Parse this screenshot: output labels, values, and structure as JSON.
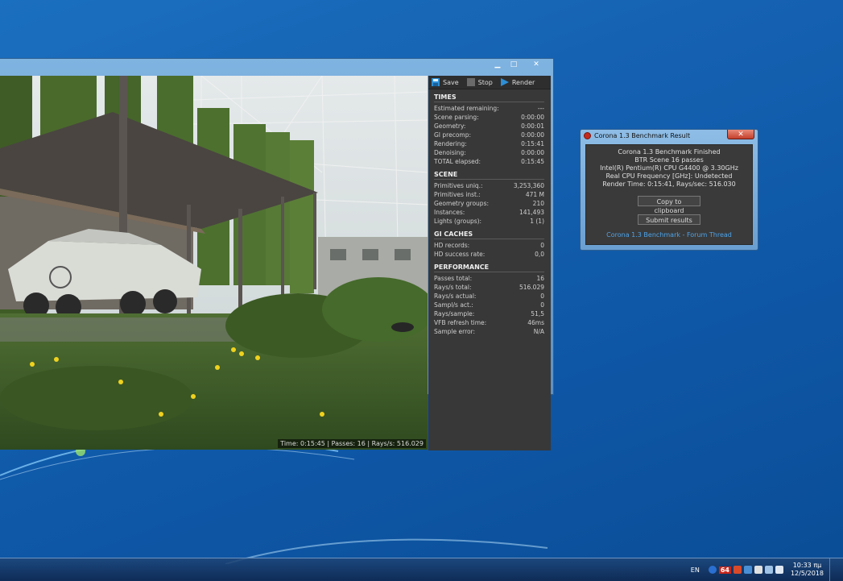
{
  "vfb": {
    "toolbar": {
      "save": "Save",
      "stop": "Stop",
      "render": "Render"
    },
    "status": "Time: 0:15:45 | Passes: 16 | Rays/s: 516.029",
    "sections": [
      {
        "title": "TIMES",
        "rows": [
          {
            "label": "Estimated remaining:",
            "value": "---"
          },
          {
            "label": "Scene parsing:",
            "value": "0:00:00"
          },
          {
            "label": "Geometry:",
            "value": "0:00:01"
          },
          {
            "label": "GI precomp:",
            "value": "0:00:00"
          },
          {
            "label": "Rendering:",
            "value": "0:15:41"
          },
          {
            "label": "Denoising:",
            "value": "0:00:00"
          },
          {
            "label": "TOTAL elapsed:",
            "value": "0:15:45"
          }
        ]
      },
      {
        "title": "SCENE",
        "rows": [
          {
            "label": "Primitives uniq.:",
            "value": "3,253,360"
          },
          {
            "label": "Primitives inst.:",
            "value": "471 M"
          },
          {
            "label": "Geometry groups:",
            "value": "210"
          },
          {
            "label": "Instances:",
            "value": "141,493"
          },
          {
            "label": "Lights (groups):",
            "value": "1 (1)"
          }
        ]
      },
      {
        "title": "GI CACHES",
        "rows": [
          {
            "label": "HD records:",
            "value": "0"
          },
          {
            "label": "HD success rate:",
            "value": "0,0"
          }
        ]
      },
      {
        "title": "PERFORMANCE",
        "rows": [
          {
            "label": "Passes total:",
            "value": "16"
          },
          {
            "label": "Rays/s total:",
            "value": "516.029"
          },
          {
            "label": "Rays/s actual:",
            "value": "0"
          },
          {
            "label": "Sampl/s act.:",
            "value": "0"
          },
          {
            "label": "Rays/sample:",
            "value": "51,5"
          },
          {
            "label": "VFB refresh time:",
            "value": "46ms"
          },
          {
            "label": "Sample error:",
            "value": "N/A"
          }
        ]
      }
    ]
  },
  "dialog": {
    "title": "Corona 1.3 Benchmark Result",
    "lines": [
      "Corona 1.3 Benchmark Finished",
      "BTR Scene 16 passes",
      "Intel(R) Pentium(R) CPU G4400 @ 3.30GHz",
      "Real CPU Frequency [GHz]: Undetected",
      "Render Time: 0:15:41, Rays/sec: 516.030"
    ],
    "copy_button": "Copy to clipboard",
    "submit_button": "Submit results",
    "link": "Corona 1.3 Benchmark - Forum Thread"
  },
  "taskbar": {
    "lang": "EN",
    "badge": "64",
    "time": "10:33 πμ",
    "date": "12/5/2018"
  },
  "colors": {
    "accent_link": "#4ea3e8",
    "panel_bg": "#383838",
    "desktop": "#1560b0"
  }
}
